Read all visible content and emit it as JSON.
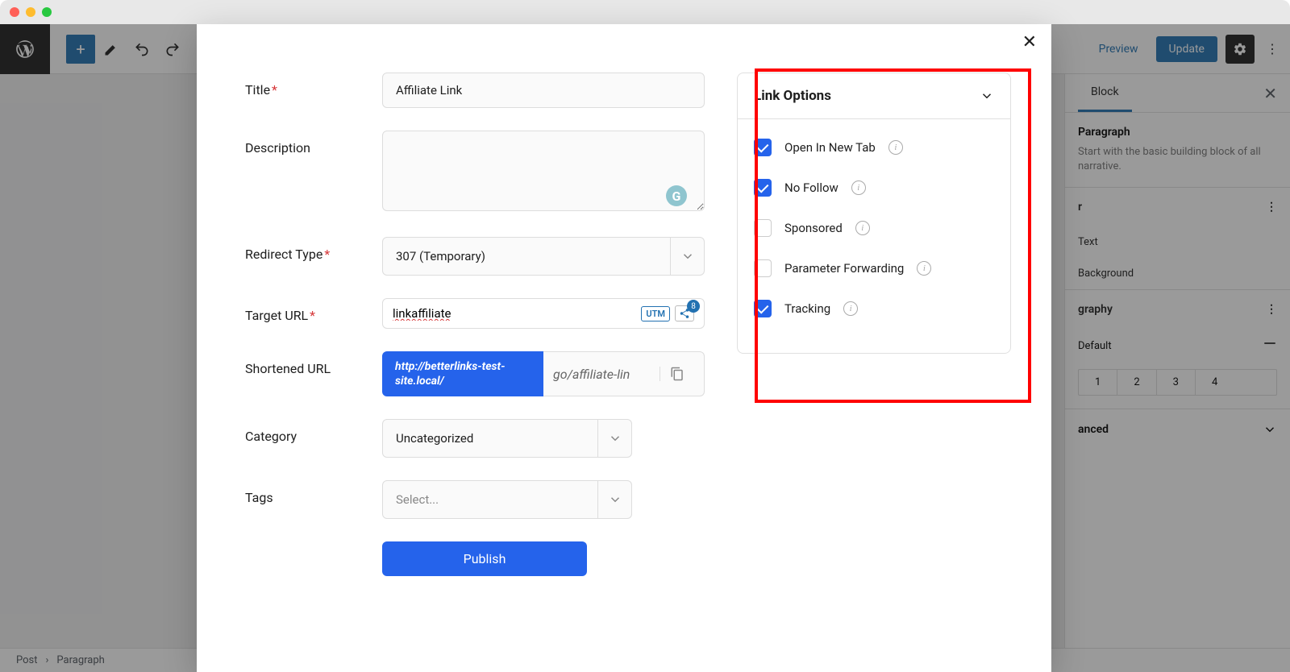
{
  "window": {
    "traffic_lights": 3
  },
  "wp": {
    "topbar": {
      "preview": "Preview",
      "update": "Update"
    },
    "sidebar": {
      "tab_active": "Block",
      "block_title": "Paragraph",
      "block_desc": "Start with the basic building block of all narrative.",
      "color_title": "r",
      "color_text": "Text",
      "color_bg": "Background",
      "typo_title": "graphy",
      "typo_default": "Default",
      "typo_opts": [
        "1",
        "2",
        "3",
        "4"
      ],
      "advanced": "anced"
    },
    "breadcrumb": {
      "root": "Post",
      "current": "Paragraph"
    }
  },
  "modal": {
    "labels": {
      "title": "Title",
      "description": "Description",
      "redirect_type": "Redirect Type",
      "target_url": "Target URL",
      "shortened_url": "Shortened URL",
      "category": "Category",
      "tags": "Tags"
    },
    "values": {
      "title": "Affiliate Link",
      "description": "",
      "redirect_type": "307 (Temporary)",
      "target_url": "linkaffiliate",
      "short_base": "http://betterlinks-test-site.local/",
      "short_slug": "go/affiliate-lin",
      "category": "Uncategorized",
      "tags_placeholder": "Select..."
    },
    "utm_label": "UTM",
    "share_count": "8",
    "publish": "Publish",
    "link_options": {
      "title": "Link Options",
      "items": [
        {
          "label": "Open In New Tab",
          "checked": true
        },
        {
          "label": "No Follow",
          "checked": true
        },
        {
          "label": "Sponsored",
          "checked": false
        },
        {
          "label": "Parameter Forwarding",
          "checked": false
        },
        {
          "label": "Tracking",
          "checked": true
        }
      ]
    }
  }
}
